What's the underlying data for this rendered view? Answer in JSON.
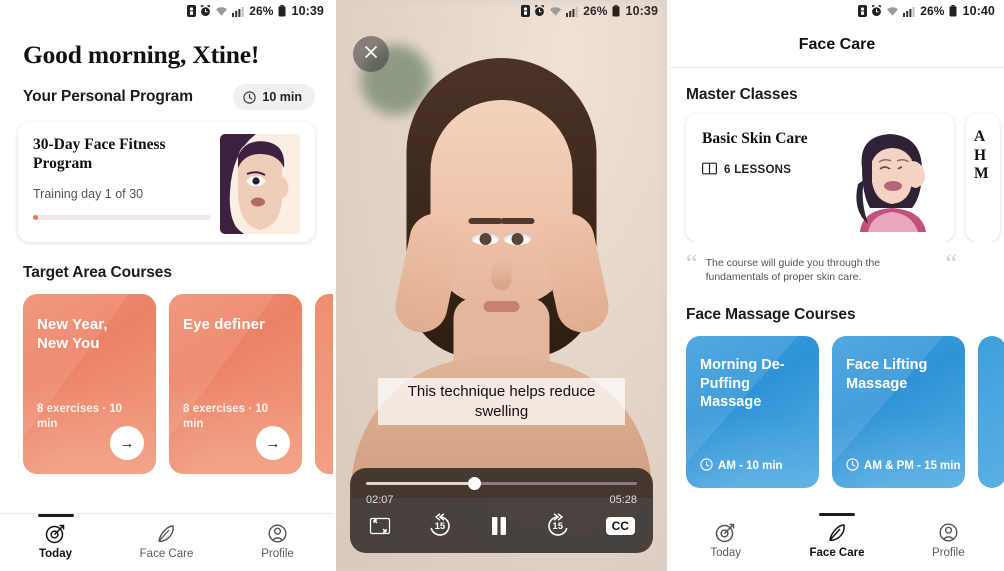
{
  "status_bar": {
    "left_time": "10:39",
    "mid_time": "10:39",
    "right_time": "10:40",
    "battery": "26%"
  },
  "left_screen": {
    "greeting": "Good morning, Xtine!",
    "personal_program_label": "Your Personal Program",
    "duration_pill": "10 min",
    "program_card": {
      "title": "30-Day Face Fitness Program",
      "subtitle": "Training day 1 of 30",
      "progress_percent": 3
    },
    "courses_heading": "Target Area Courses",
    "courses": [
      {
        "title": "New Year, New You",
        "meta": "8 exercises · 10 min",
        "arrow": "→"
      },
      {
        "title": "Eye definer",
        "meta": "8 exercises · 10 min",
        "arrow": "→"
      }
    ],
    "tabs": [
      {
        "label": "Today",
        "icon": "target-icon",
        "active": true
      },
      {
        "label": "Face Care",
        "icon": "feather-icon",
        "active": false
      },
      {
        "label": "Profile",
        "icon": "person-circle-icon",
        "active": false
      }
    ]
  },
  "video_screen": {
    "close_icon": "close-icon",
    "caption": "This technique helps reduce swelling",
    "current_time": "02:07",
    "total_time": "05:28",
    "progress_percent": 40,
    "controls": {
      "fullscreen": "expand-icon",
      "rewind": "15",
      "play_state": "pause-icon",
      "forward": "15",
      "captions": "CC"
    }
  },
  "right_screen": {
    "app_bar_title": "Face Care",
    "master_classes_heading": "Master Classes",
    "master_class": {
      "title": "Basic Skin Care",
      "lessons": "6 LESSONS",
      "description": "The course will guide you through the fundamentals of proper skin care."
    },
    "master_class_peek": "A H M",
    "massage_heading": "Face Massage Courses",
    "massage_courses": [
      {
        "title": "Morning De-Puffing Massage",
        "meta": "AM - 10 min"
      },
      {
        "title": "Face Lifting Massage",
        "meta": "AM & PM - 15 min"
      }
    ],
    "tabs": [
      {
        "label": "Today",
        "icon": "target-icon",
        "active": false
      },
      {
        "label": "Face Care",
        "icon": "feather-icon",
        "active": true
      },
      {
        "label": "Profile",
        "icon": "person-circle-icon",
        "active": false
      }
    ]
  },
  "colors": {
    "coral": "#ec8265",
    "blue": "#2e93d6",
    "accent_progress": "#e8795b"
  }
}
